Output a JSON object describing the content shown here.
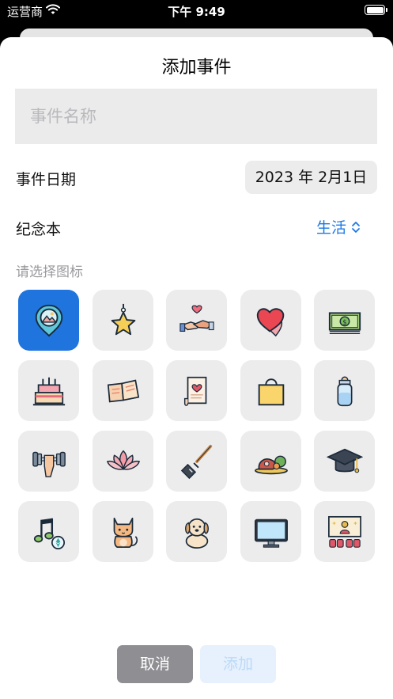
{
  "status_bar": {
    "carrier": "运营商",
    "time": "下午 9:49"
  },
  "sheet": {
    "title": "添加事件",
    "name_placeholder": "事件名称",
    "date_label": "事件日期",
    "date_value": "2023 年 2月1日",
    "notebook_label": "纪念本",
    "notebook_value": "生活",
    "icon_hint": "请选择图标",
    "icons": [
      {
        "name": "location-photo-icon",
        "selected": true
      },
      {
        "name": "star-ornament-icon",
        "selected": false
      },
      {
        "name": "holding-hands-icon",
        "selected": false
      },
      {
        "name": "hearts-icon",
        "selected": false
      },
      {
        "name": "money-stack-icon",
        "selected": false
      },
      {
        "name": "birthday-cake-icon",
        "selected": false
      },
      {
        "name": "open-book-icon",
        "selected": false
      },
      {
        "name": "love-letter-scroll-icon",
        "selected": false
      },
      {
        "name": "shopping-bag-icon",
        "selected": false
      },
      {
        "name": "baby-bottle-icon",
        "selected": false
      },
      {
        "name": "dumbbell-icon",
        "selected": false
      },
      {
        "name": "lotus-icon",
        "selected": false
      },
      {
        "name": "spatula-icon",
        "selected": false
      },
      {
        "name": "steak-meal-icon",
        "selected": false
      },
      {
        "name": "graduation-cap-icon",
        "selected": false
      },
      {
        "name": "music-note-icon",
        "selected": false
      },
      {
        "name": "cat-icon",
        "selected": false
      },
      {
        "name": "dog-icon",
        "selected": false
      },
      {
        "name": "monitor-icon",
        "selected": false
      },
      {
        "name": "cinema-screen-icon",
        "selected": false
      }
    ],
    "cancel_label": "取消",
    "add_label": "添加"
  },
  "colors": {
    "accent": "#1a78e8",
    "selected_icon_bg": "#1f75dd",
    "cancel_bg": "#8e8e93",
    "add_bg_disabled": "#e6f1fd"
  }
}
